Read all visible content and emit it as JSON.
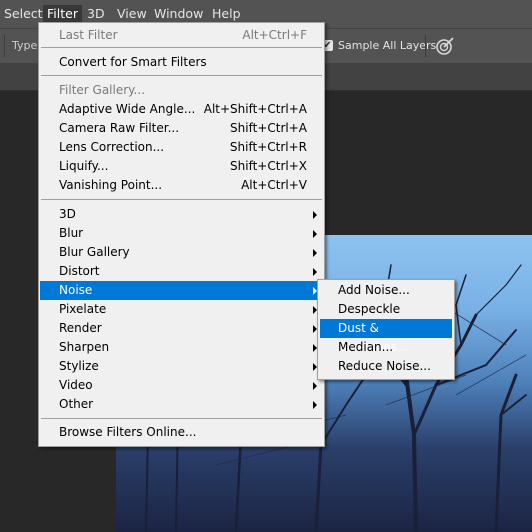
{
  "menubar": {
    "items": [
      {
        "label": "Select",
        "active": false
      },
      {
        "label": "Filter",
        "active": true
      },
      {
        "label": "3D",
        "active": false
      },
      {
        "label": "View",
        "active": false
      },
      {
        "label": "Window",
        "active": false
      },
      {
        "label": "Help",
        "active": false
      }
    ]
  },
  "options_bar": {
    "type_label": "Type:",
    "sample_all_layers": {
      "label": "Sample All Layers",
      "checked": true
    },
    "brush_icon": "pressure-brush-icon"
  },
  "filter_menu": {
    "last_filter": {
      "label": "Last Filter",
      "shortcut": "Alt+Ctrl+F",
      "disabled": true
    },
    "convert": {
      "label": "Convert for Smart Filters"
    },
    "group1": [
      {
        "label": "Filter Gallery...",
        "shortcut": "",
        "disabled": true
      },
      {
        "label": "Adaptive Wide Angle...",
        "shortcut": "Alt+Shift+Ctrl+A"
      },
      {
        "label": "Camera Raw Filter...",
        "shortcut": "Shift+Ctrl+A"
      },
      {
        "label": "Lens Correction...",
        "shortcut": "Shift+Ctrl+R"
      },
      {
        "label": "Liquify...",
        "shortcut": "Shift+Ctrl+X"
      },
      {
        "label": "Vanishing Point...",
        "shortcut": "Alt+Ctrl+V"
      }
    ],
    "submenus": [
      {
        "label": "3D"
      },
      {
        "label": "Blur"
      },
      {
        "label": "Blur Gallery"
      },
      {
        "label": "Distort"
      },
      {
        "label": "Noise",
        "highlighted": true
      },
      {
        "label": "Pixelate"
      },
      {
        "label": "Render"
      },
      {
        "label": "Sharpen"
      },
      {
        "label": "Stylize"
      },
      {
        "label": "Video"
      },
      {
        "label": "Other"
      }
    ],
    "browse": {
      "label": "Browse Filters Online..."
    }
  },
  "noise_submenu": {
    "items": [
      {
        "label": "Add Noise..."
      },
      {
        "label": "Despeckle"
      },
      {
        "label": "Dust & Scratches...",
        "highlighted": true
      },
      {
        "label": "Median..."
      },
      {
        "label": "Reduce Noise..."
      }
    ]
  },
  "colors": {
    "highlight": "#0078d7",
    "menu_bg": "#f0f0f0",
    "chrome": "#535353"
  }
}
